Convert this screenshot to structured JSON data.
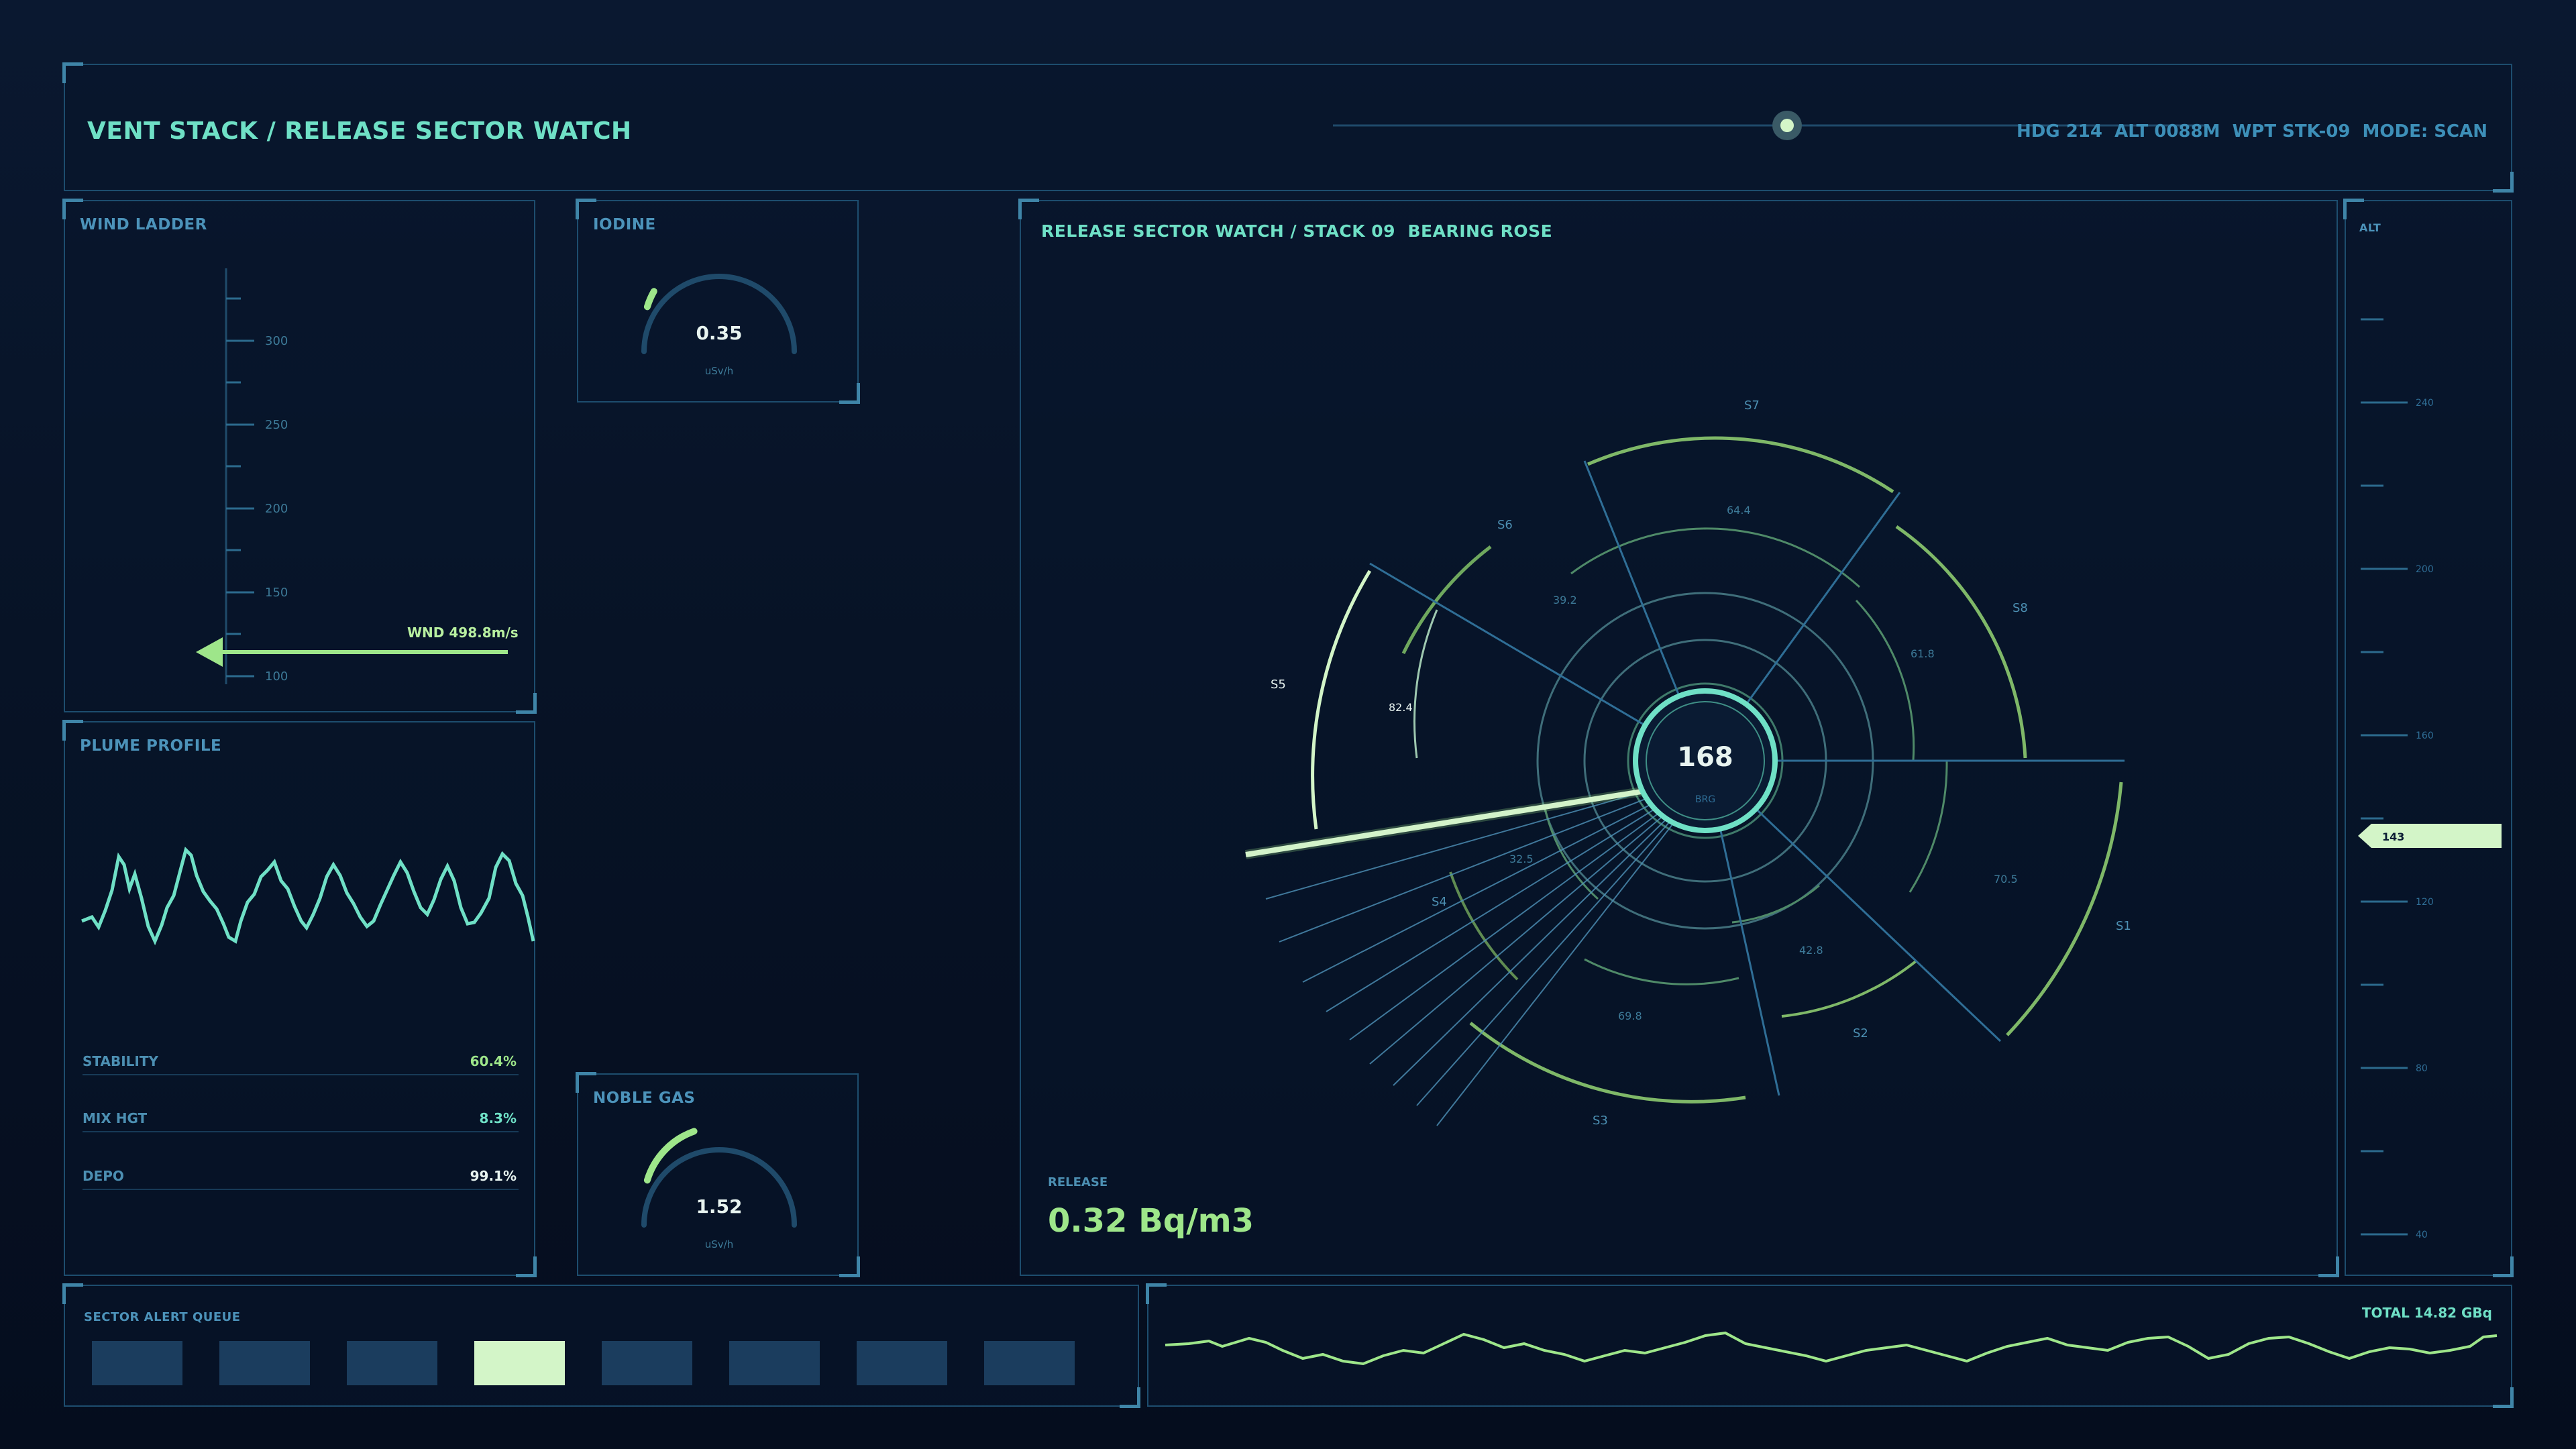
{
  "header": {
    "title": "VENT STACK / RELEASE SECTOR WATCH",
    "status": "HDG 214  ALT 0088M  WPT STK-09  MODE: SCAN"
  },
  "wind_ladder": {
    "title": "WIND LADDER",
    "ticks": [
      "300",
      "250",
      "200",
      "150",
      "100"
    ],
    "readout": "WND 498.8m/s"
  },
  "iodine": {
    "title": "IODINE",
    "value": "0.35",
    "unit": "uSv/h",
    "level": 0.06
  },
  "noble_gas": {
    "title": "NOBLE GAS",
    "value": "1.52",
    "unit": "uSv/h",
    "level": 0.25
  },
  "plume": {
    "title": "PLUME PROFILE",
    "rows": [
      {
        "label": "STABILITY",
        "value": "60.4%"
      },
      {
        "label": "MIX HGT",
        "value": "8.3%"
      },
      {
        "label": "DEPO",
        "value": "99.1%"
      }
    ]
  },
  "rose": {
    "title": "RELEASE SECTOR WATCH / STACK 09  BEARING ROSE",
    "center_value": "168",
    "center_label": "BRG",
    "release_label": "RELEASE",
    "release_value": "0.32 Bq/m3",
    "sectors": [
      "S1",
      "S2",
      "S3",
      "S4",
      "S5",
      "S6",
      "S7",
      "S8"
    ],
    "values": [
      "70.5",
      "42.8",
      "69.8",
      "32.5",
      "82.4",
      "39.2",
      "64.4",
      "61.8"
    ]
  },
  "alt_tape": {
    "title": "ALT",
    "ticks": [
      "240",
      "200",
      "160",
      "120",
      "80",
      "40"
    ],
    "marker": "143"
  },
  "alert_queue": {
    "title": "SECTOR ALERT QUEUE",
    "active_index": 3,
    "count": 8
  },
  "total": {
    "label": "TOTAL 14.82 GBq"
  },
  "colors": {
    "accent": "#6fe0c6",
    "green": "#9ee68a",
    "pale": "#d3f5c8",
    "frame": "#1d4d6e"
  }
}
